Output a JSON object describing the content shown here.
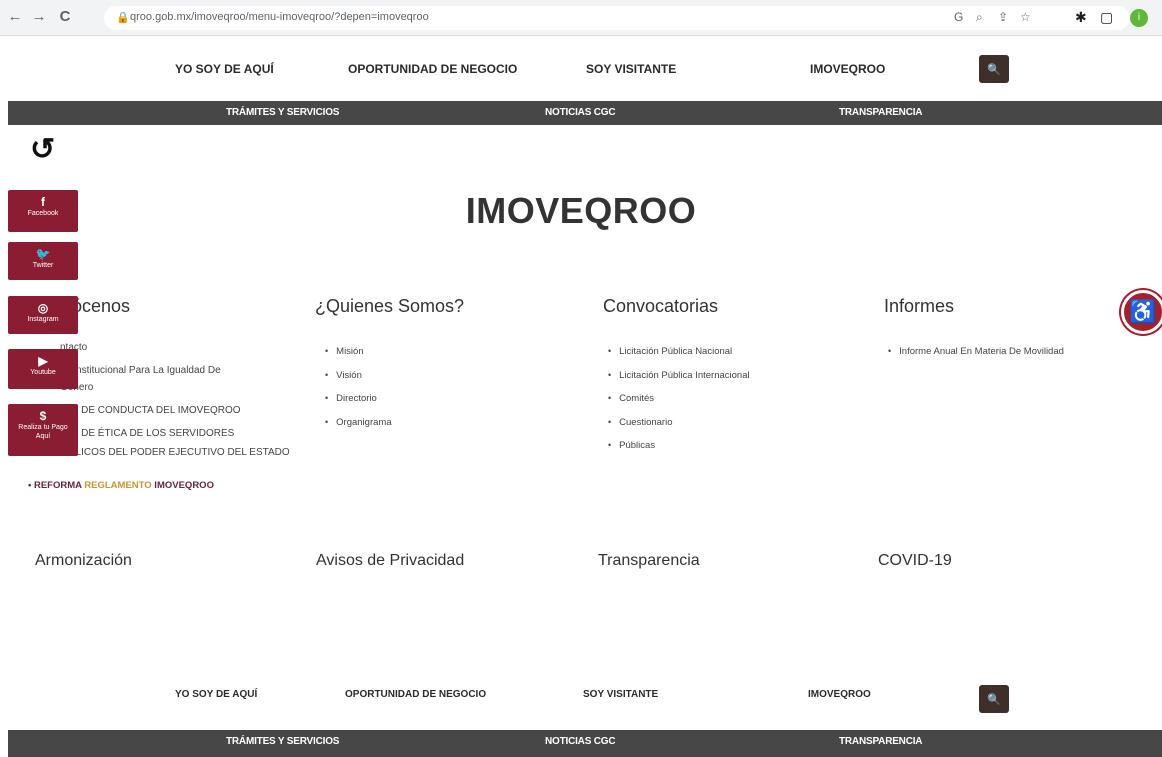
{
  "browser": {
    "url": "qroo.gob.mx/imoveqroo/menu-imoveqroo/?depen=imoveqroo",
    "back_glyph": "←",
    "forward_glyph": "→",
    "reload_glyph": "C",
    "profile_letter": "i"
  },
  "main_nav": {
    "items": [
      "YO SOY DE AQUÍ",
      "OPORTUNIDAD DE NEGOCIO",
      "SOY VISITANTE",
      "IMOVEQROO"
    ],
    "search_glyph": "🔍"
  },
  "sub_nav": {
    "items": [
      "TRÁMITES Y SERVICIOS",
      "NOTICIAS CGC",
      "TRANSPARENCIA"
    ]
  },
  "page": {
    "title": "IMOVEQROO"
  },
  "social": [
    {
      "icon": "f",
      "label": "Facebook"
    },
    {
      "icon": "🐦",
      "label": "Twitter"
    },
    {
      "icon": "◎",
      "label": "Instagram"
    },
    {
      "icon": "▶",
      "label": "Youtube"
    },
    {
      "icon": "$",
      "label": "Realiza tu Pago Aquí"
    }
  ],
  "columns": {
    "conocenos": {
      "title": "ócenos",
      "items": [
        "ntacto",
        "ité Institucional Para La Igualdad De",
        "Género",
        "IGO DE CONDUCTA DEL IMOVEQROO",
        "IGO DE ÉTICA DE LOS SERVIDORES",
        "PÚBLICOS DEL PODER EJECUTIVO DEL ESTADO"
      ],
      "reforma_pre": "• REFORMA ",
      "reforma_hl": "REGLAMENTO",
      "reforma_post": " IMOVEQROO"
    },
    "quienes": {
      "title": "¿Quienes Somos?",
      "items": [
        "Misión",
        "Visión",
        "Directorio",
        "Organigrama"
      ]
    },
    "convocatorias": {
      "title": "Convocatorias",
      "items": [
        "Licitación Pública Nacional",
        "Licitación Pública Internacional",
        "Comités",
        "Cuestionario",
        "Públicas"
      ]
    },
    "informes": {
      "title": "Informes",
      "items": [
        "Informe Anual En Materia De Movilidad"
      ]
    }
  },
  "sections": [
    "Armonización",
    "Avisos de Privacidad",
    "Transparencia",
    "COVID-19"
  ],
  "accessibility_glyph": "♿",
  "footer_nav": {
    "items": [
      "YO SOY DE AQUÍ",
      "OPORTUNIDAD DE NEGOCIO",
      "SOY VISITANTE",
      "IMOVEQROO"
    ]
  },
  "footer_sub_nav": {
    "items": [
      "TRÁMITES Y SERVICIOS",
      "NOTICIAS CGC",
      "TRANSPARENCIA"
    ]
  },
  "colors": {
    "brand": "#8b1d32",
    "dark_bar": "#474747",
    "search_button": "#3f2f2a",
    "highlight": "#c89533"
  }
}
